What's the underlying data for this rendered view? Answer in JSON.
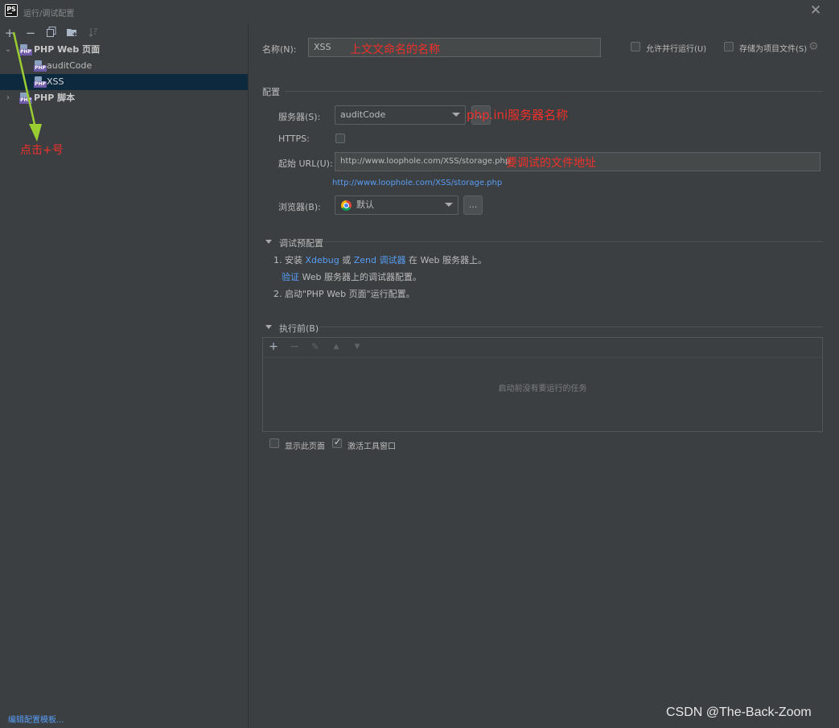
{
  "window": {
    "title": "运行/调试配置",
    "logo_text": "PS"
  },
  "left_toolbar": {
    "add": "+",
    "remove": "−"
  },
  "tree": {
    "groups": [
      {
        "label": "PHP Web 页面",
        "children": [
          "auditCode",
          "XSS"
        ]
      },
      {
        "label": "PHP 脚本"
      }
    ]
  },
  "annotations": {
    "click_plus": "点击+号",
    "name_note": "上文文命名的名称",
    "server_note": "php.ini服务器名称",
    "url_note": "要调试的文件地址"
  },
  "edit_templates_link": "编辑配置模板...",
  "form": {
    "name_label": "名称(N):",
    "name_value": "XSS",
    "allow_parallel": "允许并行运行(U)",
    "store_project": "存储为项目文件(S)",
    "section_config": "配置",
    "server_label": "服务器(S):",
    "server_value": "auditCode",
    "https_label": "HTTPS:",
    "start_url_label": "起始 URL(U):",
    "start_url_value": "http://www.loophole.com/XSS/storage.php",
    "start_url_link": "http://www.loophole.com/XSS/storage.php",
    "browser_label": "浏览器(B):",
    "browser_value": "默认",
    "ellipsis": "...",
    "debug_section": "调试预配置",
    "step1_prefix": "1. 安装",
    "xdebug": "Xdebug",
    "or": "或",
    "zend": "Zend 调试器",
    "step1_suffix": "在 Web 服务器上。",
    "verify": "验证",
    "verify_suffix": "Web 服务器上的调试器配置。",
    "step2": "2. 启动\"PHP Web 页面\"运行配置。",
    "before_launch": "执行前(B)",
    "no_tasks": "启动前没有要运行的任务",
    "show_page": "显示此页面",
    "activate_tool": "激活工具窗口"
  },
  "watermark": "CSDN @The-Back-Zoom"
}
